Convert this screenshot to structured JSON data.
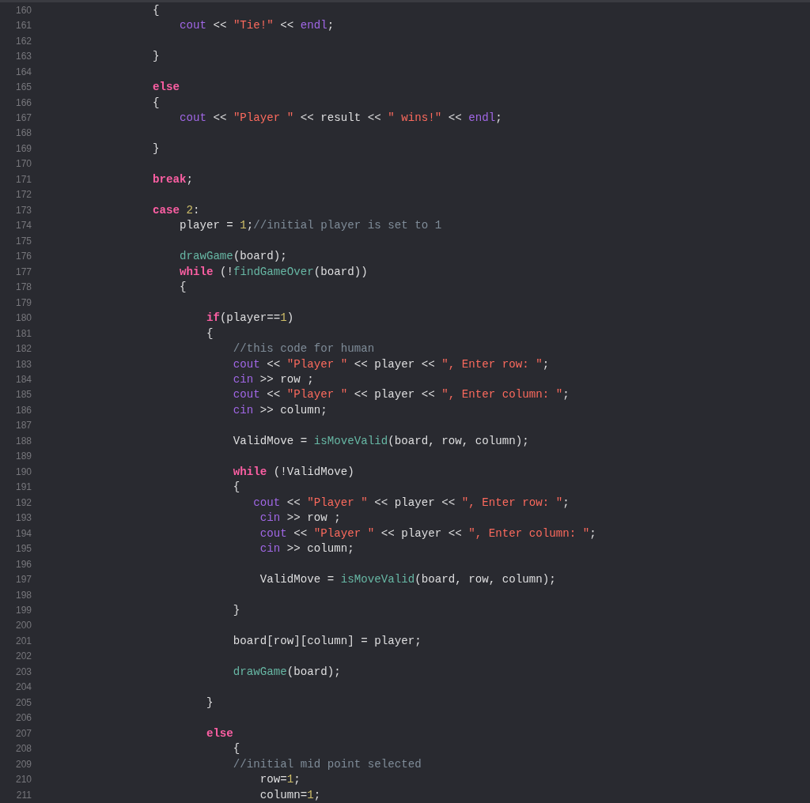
{
  "editor": {
    "lines": [
      {
        "number": "160",
        "tokens": [
          {
            "kind": "plain",
            "text": "                {"
          }
        ]
      },
      {
        "number": "161",
        "tokens": [
          {
            "kind": "sys",
            "text": "                    cout"
          },
          {
            "kind": "plain",
            "text": " << "
          },
          {
            "kind": "str",
            "text": "\"Tie!\""
          },
          {
            "kind": "plain",
            "text": " << "
          },
          {
            "kind": "sys",
            "text": "endl"
          },
          {
            "kind": "plain",
            "text": ";"
          }
        ]
      },
      {
        "number": "162"
      },
      {
        "number": "163",
        "tokens": [
          {
            "kind": "plain",
            "text": "                }"
          }
        ]
      },
      {
        "number": "164"
      },
      {
        "number": "165",
        "tokens": [
          {
            "kind": "kw",
            "text": "                else"
          }
        ]
      },
      {
        "number": "166",
        "tokens": [
          {
            "kind": "plain",
            "text": "                {"
          }
        ]
      },
      {
        "number": "167",
        "tokens": [
          {
            "kind": "sys",
            "text": "                    cout"
          },
          {
            "kind": "plain",
            "text": " << "
          },
          {
            "kind": "str",
            "text": "\"Player \""
          },
          {
            "kind": "plain",
            "text": " << result << "
          },
          {
            "kind": "str",
            "text": "\" wins!\""
          },
          {
            "kind": "plain",
            "text": " << "
          },
          {
            "kind": "sys",
            "text": "endl"
          },
          {
            "kind": "plain",
            "text": ";"
          }
        ]
      },
      {
        "number": "168"
      },
      {
        "number": "169",
        "tokens": [
          {
            "kind": "plain",
            "text": "                }"
          }
        ]
      },
      {
        "number": "170"
      },
      {
        "number": "171",
        "tokens": [
          {
            "kind": "kw",
            "text": "                break"
          },
          {
            "kind": "plain",
            "text": ";"
          }
        ]
      },
      {
        "number": "172"
      },
      {
        "number": "173",
        "tokens": [
          {
            "kind": "kw",
            "text": "                case"
          },
          {
            "kind": "num",
            "text": " 2"
          },
          {
            "kind": "plain",
            "text": ":"
          }
        ]
      },
      {
        "number": "174",
        "tokens": [
          {
            "kind": "plain",
            "text": "                    player = "
          },
          {
            "kind": "num",
            "text": "1"
          },
          {
            "kind": "plain",
            "text": ";"
          },
          {
            "kind": "cmt",
            "text": "//initial player is set to 1"
          }
        ]
      },
      {
        "number": "175"
      },
      {
        "number": "176",
        "tokens": [
          {
            "kind": "fn",
            "text": "                    drawGame"
          },
          {
            "kind": "plain",
            "text": "(board);"
          }
        ]
      },
      {
        "number": "177",
        "tokens": [
          {
            "kind": "kw",
            "text": "                    while"
          },
          {
            "kind": "plain",
            "text": " (!"
          },
          {
            "kind": "fn",
            "text": "findGameOver"
          },
          {
            "kind": "plain",
            "text": "(board))"
          }
        ]
      },
      {
        "number": "178",
        "tokens": [
          {
            "kind": "plain",
            "text": "                    {"
          }
        ]
      },
      {
        "number": "179"
      },
      {
        "number": "180",
        "tokens": [
          {
            "kind": "kw",
            "text": "                        if"
          },
          {
            "kind": "plain",
            "text": "(player=="
          },
          {
            "kind": "num",
            "text": "1"
          },
          {
            "kind": "plain",
            "text": ")"
          }
        ]
      },
      {
        "number": "181",
        "tokens": [
          {
            "kind": "plain",
            "text": "                        {"
          }
        ]
      },
      {
        "number": "182",
        "tokens": [
          {
            "kind": "cmt",
            "text": "                            //this code for human"
          }
        ]
      },
      {
        "number": "183",
        "tokens": [
          {
            "kind": "sys",
            "text": "                            cout"
          },
          {
            "kind": "plain",
            "text": " << "
          },
          {
            "kind": "str",
            "text": "\"Player \""
          },
          {
            "kind": "plain",
            "text": " << player << "
          },
          {
            "kind": "str",
            "text": "\", Enter row: \""
          },
          {
            "kind": "plain",
            "text": ";"
          }
        ]
      },
      {
        "number": "184",
        "tokens": [
          {
            "kind": "sys",
            "text": "                            cin"
          },
          {
            "kind": "plain",
            "text": " >> row ;"
          }
        ]
      },
      {
        "number": "185",
        "tokens": [
          {
            "kind": "sys",
            "text": "                            cout"
          },
          {
            "kind": "plain",
            "text": " << "
          },
          {
            "kind": "str",
            "text": "\"Player \""
          },
          {
            "kind": "plain",
            "text": " << player << "
          },
          {
            "kind": "str",
            "text": "\", Enter column: \""
          },
          {
            "kind": "plain",
            "text": ";"
          }
        ]
      },
      {
        "number": "186",
        "tokens": [
          {
            "kind": "sys",
            "text": "                            cin"
          },
          {
            "kind": "plain",
            "text": " >> column;"
          }
        ]
      },
      {
        "number": "187"
      },
      {
        "number": "188",
        "tokens": [
          {
            "kind": "plain",
            "text": "                            ValidMove = "
          },
          {
            "kind": "fn",
            "text": "isMoveValid"
          },
          {
            "kind": "plain",
            "text": "(board, row, column);"
          }
        ]
      },
      {
        "number": "189"
      },
      {
        "number": "190",
        "tokens": [
          {
            "kind": "kw",
            "text": "                            while"
          },
          {
            "kind": "plain",
            "text": " (!ValidMove)"
          }
        ]
      },
      {
        "number": "191",
        "tokens": [
          {
            "kind": "plain",
            "text": "                            {"
          }
        ]
      },
      {
        "number": "192",
        "tokens": [
          {
            "kind": "sys",
            "text": "                               cout"
          },
          {
            "kind": "plain",
            "text": " << "
          },
          {
            "kind": "str",
            "text": "\"Player \""
          },
          {
            "kind": "plain",
            "text": " << player << "
          },
          {
            "kind": "str",
            "text": "\", Enter row: \""
          },
          {
            "kind": "plain",
            "text": ";"
          }
        ]
      },
      {
        "number": "193",
        "tokens": [
          {
            "kind": "sys",
            "text": "                                cin"
          },
          {
            "kind": "plain",
            "text": " >> row ;"
          }
        ]
      },
      {
        "number": "194",
        "tokens": [
          {
            "kind": "sys",
            "text": "                                cout"
          },
          {
            "kind": "plain",
            "text": " << "
          },
          {
            "kind": "str",
            "text": "\"Player \""
          },
          {
            "kind": "plain",
            "text": " << player << "
          },
          {
            "kind": "str",
            "text": "\", Enter column: \""
          },
          {
            "kind": "plain",
            "text": ";"
          }
        ]
      },
      {
        "number": "195",
        "tokens": [
          {
            "kind": "sys",
            "text": "                                cin"
          },
          {
            "kind": "plain",
            "text": " >> column;"
          }
        ]
      },
      {
        "number": "196"
      },
      {
        "number": "197",
        "tokens": [
          {
            "kind": "plain",
            "text": "                                ValidMove = "
          },
          {
            "kind": "fn",
            "text": "isMoveValid"
          },
          {
            "kind": "plain",
            "text": "(board, row, column);"
          }
        ]
      },
      {
        "number": "198"
      },
      {
        "number": "199",
        "tokens": [
          {
            "kind": "plain",
            "text": "                            }"
          }
        ]
      },
      {
        "number": "200"
      },
      {
        "number": "201",
        "tokens": [
          {
            "kind": "plain",
            "text": "                            board[row][column] = player;"
          }
        ]
      },
      {
        "number": "202"
      },
      {
        "number": "203",
        "tokens": [
          {
            "kind": "fn",
            "text": "                            drawGame"
          },
          {
            "kind": "plain",
            "text": "(board);"
          }
        ]
      },
      {
        "number": "204"
      },
      {
        "number": "205",
        "tokens": [
          {
            "kind": "plain",
            "text": "                        }"
          }
        ]
      },
      {
        "number": "206"
      },
      {
        "number": "207",
        "tokens": [
          {
            "kind": "kw",
            "text": "                        else"
          }
        ]
      },
      {
        "number": "208",
        "tokens": [
          {
            "kind": "plain",
            "text": "                            {"
          }
        ]
      },
      {
        "number": "209",
        "tokens": [
          {
            "kind": "cmt",
            "text": "                            //initial mid point selected"
          }
        ]
      },
      {
        "number": "210",
        "tokens": [
          {
            "kind": "plain",
            "text": "                                row="
          },
          {
            "kind": "num",
            "text": "1"
          },
          {
            "kind": "plain",
            "text": ";"
          }
        ]
      },
      {
        "number": "211",
        "tokens": [
          {
            "kind": "plain",
            "text": "                                column="
          },
          {
            "kind": "num",
            "text": "1"
          },
          {
            "kind": "plain",
            "text": ";"
          }
        ]
      }
    ]
  }
}
